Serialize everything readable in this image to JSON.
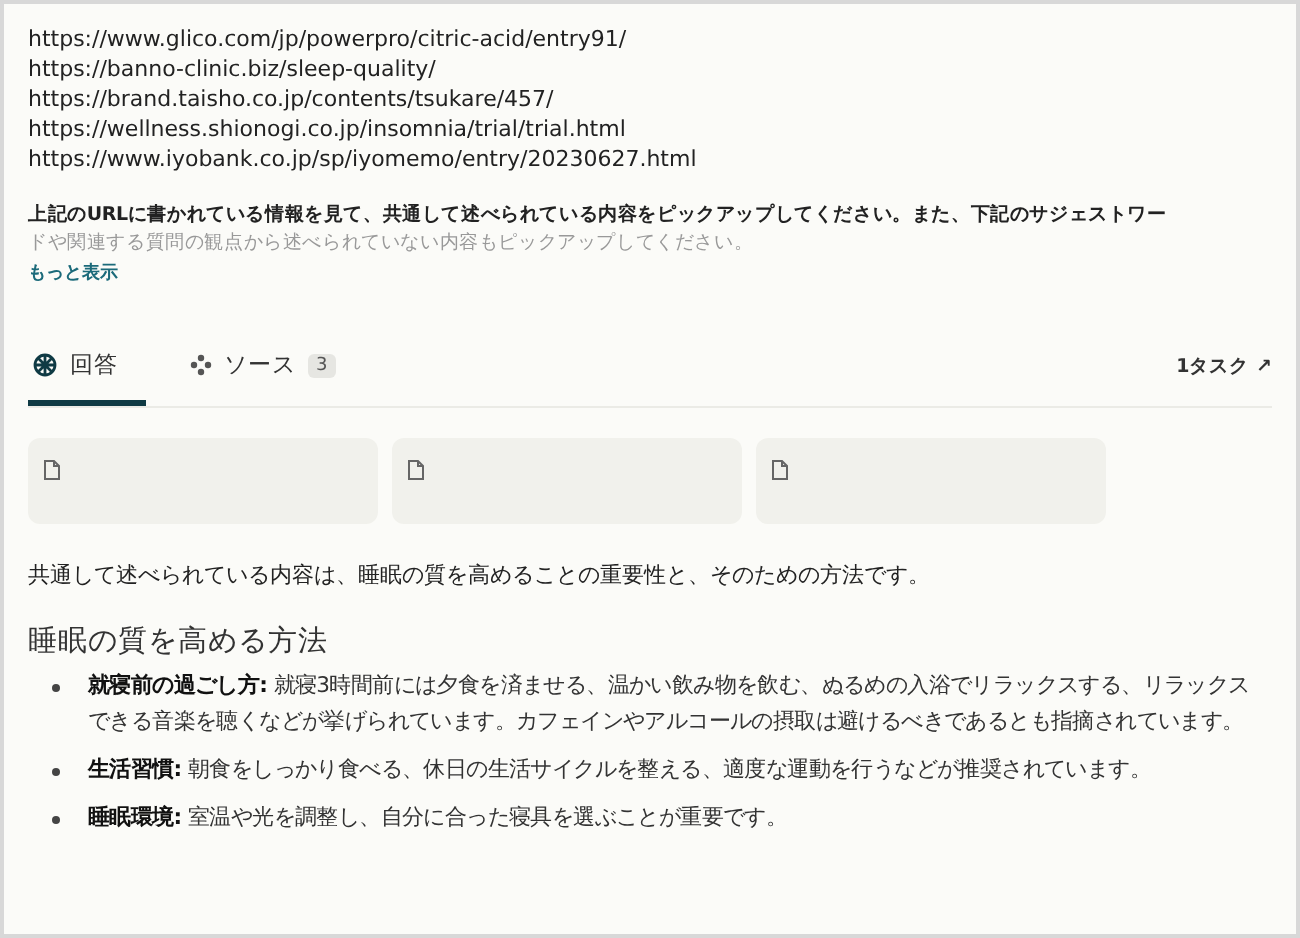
{
  "urls": [
    "https://www.glico.com/jp/powerpro/citric-acid/entry91/",
    "https://banno-clinic.biz/sleep-quality/",
    "https://brand.taisho.co.jp/contents/tsukare/457/",
    "https://wellness.shionogi.co.jp/insomnia/trial/trial.html",
    "https://www.iyobank.co.jp/sp/iyomemo/entry/20230627.html"
  ],
  "prompt": {
    "line1": "上記のURLに書かれている情報を見て、共通して述べられている内容をピックアップしてください。また、下記のサジェストワー",
    "line2": "ドや関連する質問の観点から述べられていない内容もピックアップしてください。",
    "more": "もっと表示"
  },
  "tabs": [
    {
      "kind": "answer",
      "label": "回答",
      "selected": true
    },
    {
      "kind": "sources",
      "label": "ソース",
      "count": "3",
      "selected": false
    }
  ],
  "task_link": "1タスク ↗",
  "source_cards": [
    {
      "kind": "document"
    },
    {
      "kind": "document"
    },
    {
      "kind": "document"
    }
  ],
  "answer": {
    "intro": "共通して述べられている内容は、睡眠の質を高めることの重要性と、そのための方法です。",
    "heading": "睡眠の質を高める方法",
    "bullets": [
      "**就寝前の過ごし方:** 就寝3時間前には夕食を済ませる、温かい飲み物を飲む、ぬるめの入浴でリラックスする、リラックスできる音楽を聴くなどが挙げられています。カフェインやアルコールの摂取は避けるべきであるとも指摘されています。",
      "**生活習慣:** 朝食をしっかり食べる、休日の生活サイクルを整える、適度な運動を行うなどが推奨されています。",
      "**睡眠環境:** 室温や光を調整し、自分に合った寝具を選ぶことが重要です。"
    ]
  }
}
